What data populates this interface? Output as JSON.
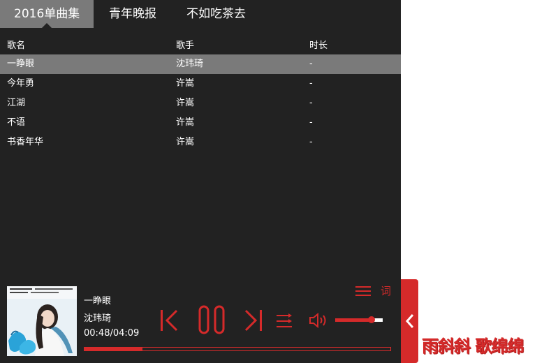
{
  "tabs": [
    {
      "label": "2016单曲集",
      "active": true
    },
    {
      "label": "青年晚报",
      "active": false
    },
    {
      "label": "不如吃茶去",
      "active": false
    }
  ],
  "table": {
    "headers": [
      "歌名",
      "歌手",
      "时长"
    ],
    "rows": [
      {
        "title": "一睁眼",
        "artist": "沈玮琦",
        "duration": "-"
      },
      {
        "title": "今年勇",
        "artist": "许嵩",
        "duration": "-"
      },
      {
        "title": "江湖",
        "artist": "许嵩",
        "duration": "-"
      },
      {
        "title": "不语",
        "artist": "许嵩",
        "duration": "-"
      },
      {
        "title": "书香年华",
        "artist": "许嵩",
        "duration": "-"
      }
    ],
    "active_index": 0
  },
  "now_playing": {
    "title": "一睁眼",
    "artist": "沈玮琦",
    "time": "00:48/04:09",
    "progress_fraction": 0.19
  },
  "controls": {
    "lyrics_label": "词",
    "volume_fraction": 0.76,
    "icons": [
      "playlist-icon",
      "previous-icon",
      "pause-icon",
      "next-icon",
      "shuffle-icon",
      "volume-icon",
      "chevron-left-icon"
    ]
  },
  "colors": {
    "accent": "#d52a2a",
    "background": "#222222",
    "highlight": "#7a7a7a"
  },
  "slogan": "雨斜斜 歌绵绵"
}
